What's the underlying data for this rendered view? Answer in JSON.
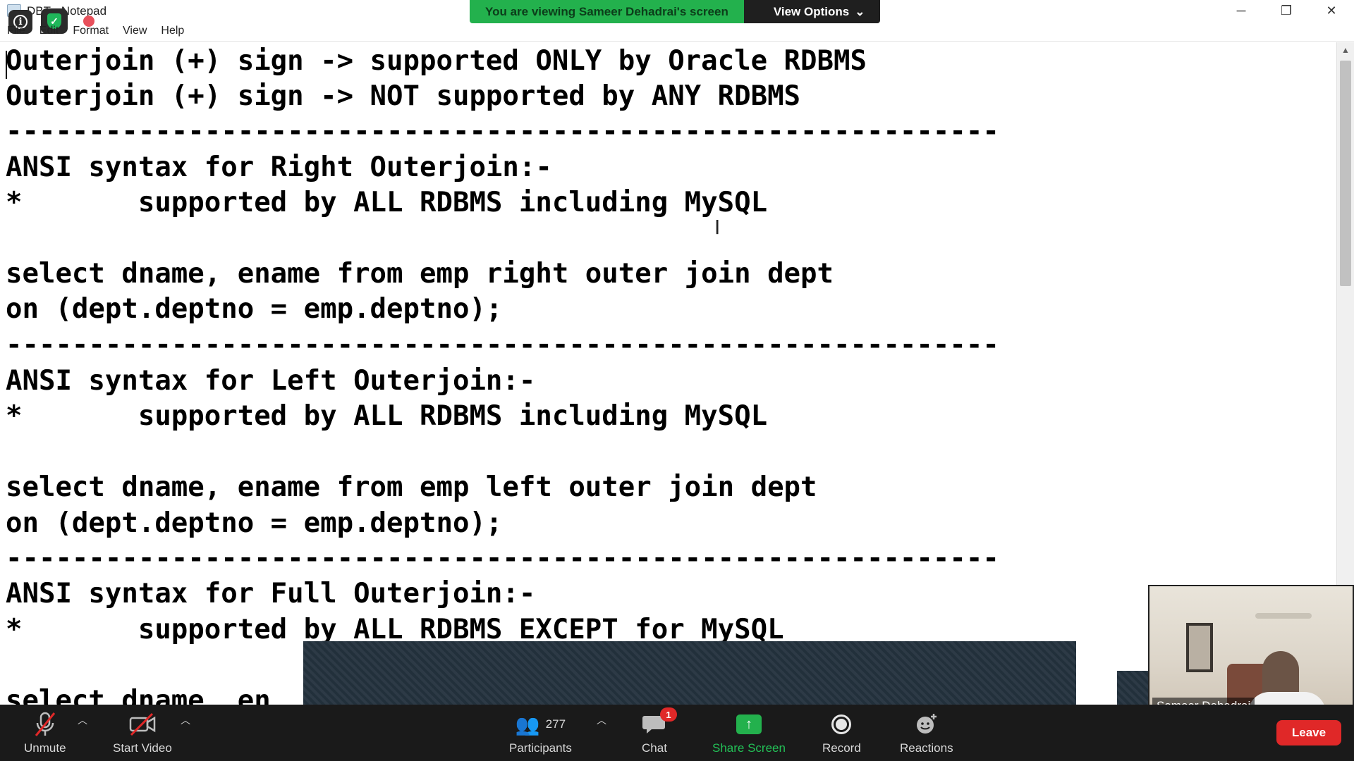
{
  "window": {
    "title": "DBT - Notepad",
    "menu": [
      "File",
      "Edit",
      "Format",
      "View",
      "Help"
    ],
    "controls": {
      "minimize": "─",
      "restore": "❐",
      "close": "✕"
    }
  },
  "share_banner": {
    "text": "You are viewing Sameer Dehadrai's screen",
    "view_options": "View Options"
  },
  "editor": {
    "lines": [
      "Outerjoin (+) sign -> supported ONLY by Oracle RDBMS",
      "Outerjoin (+) sign -> NOT supported by ANY RDBMS",
      "------------------------------------------------------------",
      "ANSI syntax for Right Outerjoin:-",
      "*       supported by ALL RDBMS including MySQL",
      "",
      "select dname, ename from emp right outer join dept",
      "on (dept.deptno = emp.deptno);",
      "------------------------------------------------------------",
      "ANSI syntax for Left Outerjoin:-",
      "*       supported by ALL RDBMS including MySQL",
      "",
      "select dname, ename from emp left outer join dept",
      "on (dept.deptno = emp.deptno);",
      "------------------------------------------------------------",
      "ANSI syntax for Full Outerjoin:-",
      "*       supported by ALL RDBMS EXCEPT for MySQL",
      "",
      "select dname, en"
    ]
  },
  "video": {
    "participant_name": "Sameer Dehadrai"
  },
  "toolbar": {
    "unmute": "Unmute",
    "start_video": "Start Video",
    "participants": "Participants",
    "participants_count": "277",
    "chat": "Chat",
    "chat_badge": "1",
    "share_screen": "Share Screen",
    "record": "Record",
    "reactions": "Reactions",
    "leave": "Leave"
  },
  "colors": {
    "share_green": "#23b14d",
    "leave_red": "#e02828",
    "toolbar_bg": "#1a1a1a"
  }
}
